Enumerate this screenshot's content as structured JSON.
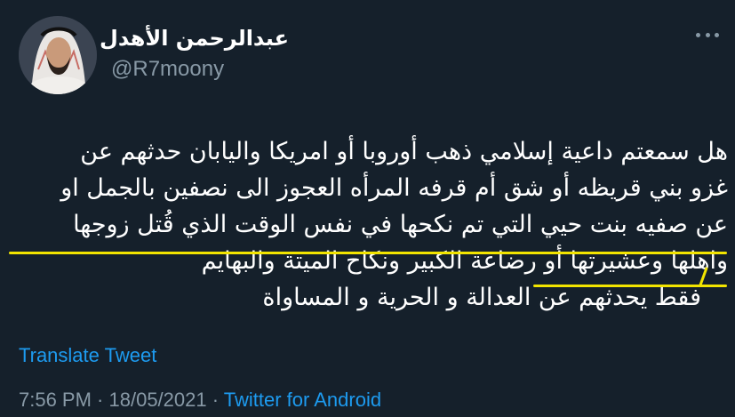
{
  "user": {
    "display_name": "عبدالرحمن الأهدل",
    "handle": "@R7moony"
  },
  "tweet": {
    "lines": [
      "هل سمعتم داعية إسلامي ذهب أوروبا أو امريكا واليابان حدثهم عن",
      "غزو بني قريظه أو شق أم قرفه المرأه العجوز الى نصفين بالجمل او",
      "عن صفيه بنت حيي التي تم نكحها في نفس الوقت الذي قُتل زوجها",
      "واهلها وعشيرتها أو رضاعة الكبير ونكاح الميتة والبهايم",
      "فقط يحدثهم عن العدالة و الحرية و المساواة"
    ]
  },
  "actions": {
    "translate_label": "Translate Tweet"
  },
  "meta": {
    "time": "7:56 PM",
    "separator": " · ",
    "date": "18/05/2021",
    "source": "Twitter for Android"
  },
  "colors": {
    "background": "#15202b",
    "text": "#ffffff",
    "muted": "#8899a6",
    "link": "#1d9bf0",
    "highlight_underline": "#f2e400"
  },
  "icons": {
    "more": "more-horizontal-icon",
    "avatar": "user-avatar"
  }
}
